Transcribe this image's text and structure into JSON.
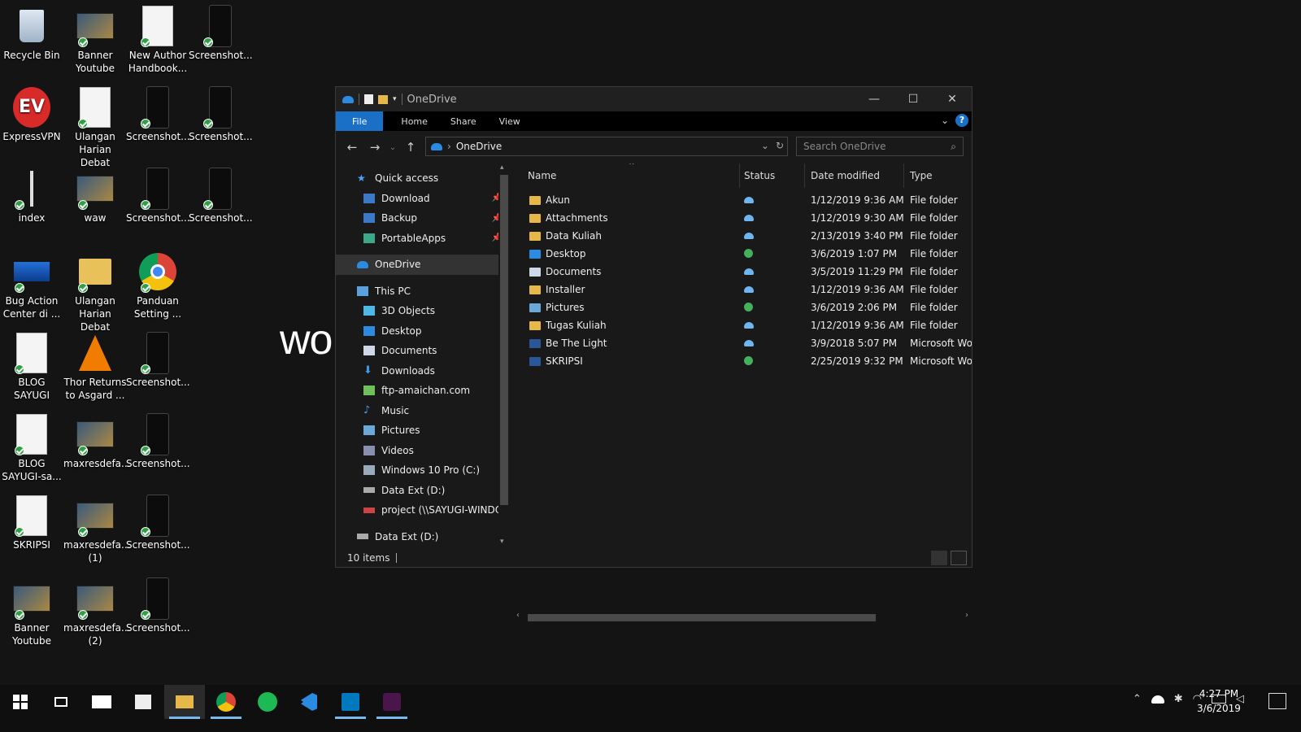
{
  "desktop": {
    "wallpaper_text": "worl",
    "icons": [
      {
        "label": "Recycle Bin"
      },
      {
        "label": "Banner Youtube"
      },
      {
        "label": "New Author Handbook..."
      },
      {
        "label": "Screenshot..."
      },
      {
        "label": "ExpressVPN"
      },
      {
        "label": "Ulangan Harian Debat"
      },
      {
        "label": "Screenshot..."
      },
      {
        "label": "Screenshot..."
      },
      {
        "label": "index"
      },
      {
        "label": "waw"
      },
      {
        "label": "Screenshot..."
      },
      {
        "label": "Screenshot..."
      },
      {
        "label": "Bug Action Center di ..."
      },
      {
        "label": "Ulangan Harian Debat"
      },
      {
        "label": "Panduan Setting ..."
      },
      {
        "label": "BLOG SAYUGI"
      },
      {
        "label": "Thor Returns to Asgard ..."
      },
      {
        "label": "Screenshot..."
      },
      {
        "label": "BLOG SAYUGI-sa..."
      },
      {
        "label": "maxresdefa..."
      },
      {
        "label": "Screenshot..."
      },
      {
        "label": "SKRIPSI"
      },
      {
        "label": "maxresdefa... (1)"
      },
      {
        "label": "Screenshot..."
      },
      {
        "label": "Banner Youtube"
      },
      {
        "label": "maxresdefa... (2)"
      },
      {
        "label": "Screenshot..."
      }
    ],
    "vpn_logo_text": "EV"
  },
  "explorer": {
    "title": "OneDrive",
    "ribbon_tabs": {
      "file": "File",
      "home": "Home",
      "share": "Share",
      "view": "View"
    },
    "help_glyph": "?",
    "address": "OneDrive",
    "search_placeholder": "Search OneDrive",
    "nav": {
      "quick_access": "Quick access",
      "quick_items": [
        "Download",
        "Backup",
        "PortableApps"
      ],
      "onedrive": "OneDrive",
      "this_pc": "This PC",
      "pc_items": [
        "3D Objects",
        "Desktop",
        "Documents",
        "Downloads",
        "ftp-amaichan.com",
        "Music",
        "Pictures",
        "Videos",
        "Windows 10 Pro (C:)",
        "Data Ext (D:)",
        "project (\\\\SAYUGI-WINDO"
      ],
      "data_ext": "Data Ext (D:)"
    },
    "columns": {
      "name": "Name",
      "status": "Status",
      "date_modified": "Date modified",
      "type": "Type"
    },
    "files": [
      {
        "name": "Akun",
        "status": "cloud",
        "date": "1/12/2019 9:36 AM",
        "type": "File folder",
        "icon": "folder"
      },
      {
        "name": "Attachments",
        "status": "cloud",
        "date": "1/12/2019 9:30 AM",
        "type": "File folder",
        "icon": "folder"
      },
      {
        "name": "Data Kuliah",
        "status": "cloud",
        "date": "2/13/2019 3:40 PM",
        "type": "File folder",
        "icon": "folder"
      },
      {
        "name": "Desktop",
        "status": "synced",
        "date": "3/6/2019 1:07 PM",
        "type": "File folder",
        "icon": "blue"
      },
      {
        "name": "Documents",
        "status": "cloud",
        "date": "3/5/2019 11:29 PM",
        "type": "File folder",
        "icon": "doc"
      },
      {
        "name": "Installer",
        "status": "cloud",
        "date": "1/12/2019 9:36 AM",
        "type": "File folder",
        "icon": "folder"
      },
      {
        "name": "Pictures",
        "status": "synced",
        "date": "3/6/2019 2:06 PM",
        "type": "File folder",
        "icon": "pic"
      },
      {
        "name": "Tugas Kuliah",
        "status": "cloud",
        "date": "1/12/2019 9:36 AM",
        "type": "File folder",
        "icon": "folder"
      },
      {
        "name": "Be The Light",
        "status": "cloud",
        "date": "3/9/2018 5:07 PM",
        "type": "Microsoft Wor",
        "icon": "word"
      },
      {
        "name": "SKRIPSI",
        "status": "synced",
        "date": "2/25/2019 9:32 PM",
        "type": "Microsoft Wor",
        "icon": "word"
      }
    ],
    "status_bar": "10 items"
  },
  "taskbar": {
    "time": "4:27 PM",
    "date": "3/6/2019"
  },
  "colors": {
    "accent": "#1a6fc7",
    "window_bg": "#191919",
    "folder": "#e6b84a",
    "synced": "#43b05c"
  }
}
